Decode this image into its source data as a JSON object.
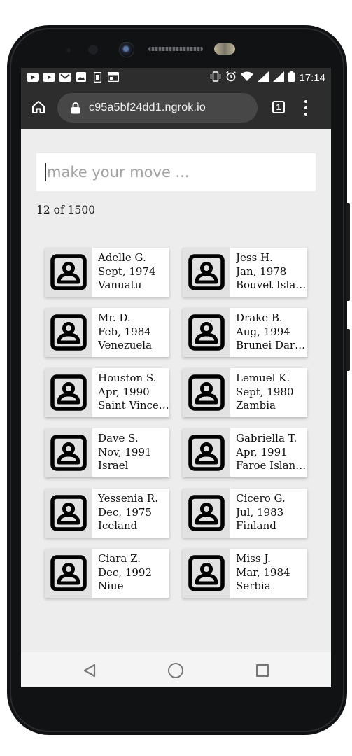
{
  "status_bar": {
    "time": "17:14",
    "left_icons": [
      "youtube-icon",
      "youtube-icon",
      "gmail-icon",
      "image-icon",
      "sim-icon",
      "browser-icon"
    ],
    "right_icons": [
      "vibrate-icon",
      "alarm-icon",
      "wifi-icon",
      "signal-icon",
      "signal-icon",
      "battery-icon"
    ]
  },
  "browser": {
    "url": "c95a5bf24dd1.ngrok.io",
    "tab_count": "1"
  },
  "search": {
    "placeholder": "make your move ...",
    "value": ""
  },
  "count_text": "12 of 1500",
  "cards": [
    {
      "name": "Adelle G.",
      "date": "Sept, 1974",
      "country": "Vanuatu"
    },
    {
      "name": "Jess H.",
      "date": "Jan, 1978",
      "country": "Bouvet Island"
    },
    {
      "name": "Mr. D.",
      "date": "Feb, 1984",
      "country": "Venezuela"
    },
    {
      "name": "Drake B.",
      "date": "Aug, 1994",
      "country": "Brunei Darussalam"
    },
    {
      "name": "Houston S.",
      "date": "Apr, 1990",
      "country": "Saint Vincent"
    },
    {
      "name": "Lemuel K.",
      "date": "Sept, 1980",
      "country": "Zambia"
    },
    {
      "name": "Dave S.",
      "date": "Nov, 1991",
      "country": "Israel"
    },
    {
      "name": "Gabriella T.",
      "date": "Apr, 1991",
      "country": "Faroe Islands"
    },
    {
      "name": "Yessenia R.",
      "date": "Dec, 1975",
      "country": "Iceland"
    },
    {
      "name": "Cicero G.",
      "date": "Jul, 1983",
      "country": "Finland"
    },
    {
      "name": "Ciara Z.",
      "date": "Dec, 1992",
      "country": "Niue"
    },
    {
      "name": "Miss J.",
      "date": "Mar, 1984",
      "country": "Serbia"
    }
  ],
  "colors": {
    "browser_chrome": "#2d2d2d",
    "page_background": "#ededed"
  }
}
